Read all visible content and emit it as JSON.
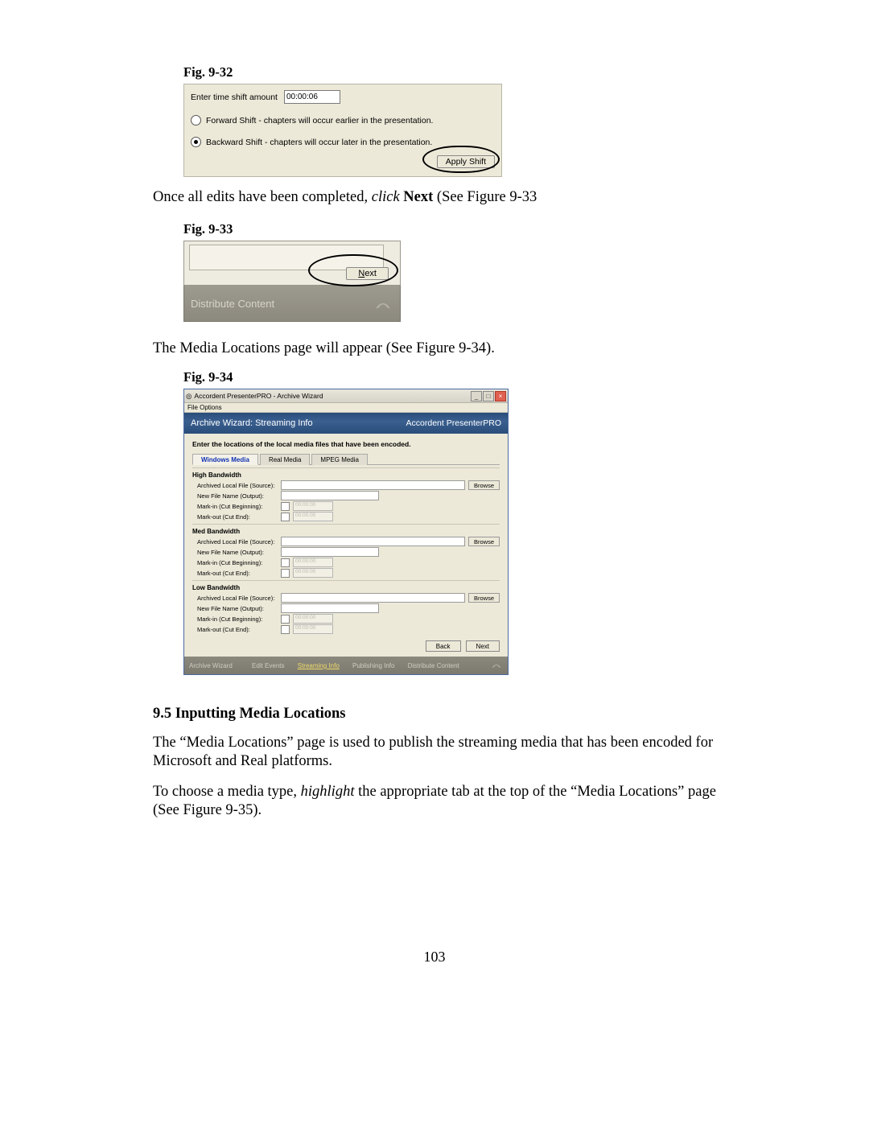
{
  "captions": {
    "fig32": "Fig. 9-32",
    "fig33": "Fig. 9-33",
    "fig34": "Fig.  9-34"
  },
  "paragraphs": {
    "p1_a": "Once all edits have been completed, ",
    "p1_b": "click",
    "p1_c": " Next",
    "p1_d": " (See Figure 9-33",
    "p2": "The Media Locations page will appear (See Figure 9-34).",
    "section": "9.5  Inputting Media Locations",
    "p3": "The “Media Locations” page is used to publish the streaming media that has been encoded for Microsoft and Real platforms.",
    "p4_a": "To choose a media type, ",
    "p4_b": "highlight",
    "p4_c": " the appropriate tab at the top of the “Media Locations” page (See Figure 9-35)."
  },
  "page_number": "103",
  "fig32": {
    "enter_label": "Enter time shift amount",
    "time_value": "00:00:06",
    "opt1": "Forward Shift - chapters will occur earlier in the presentation.",
    "opt2": "Backward Shift - chapters will occur later in the presentation.",
    "apply_btn": "Apply Shift"
  },
  "fig33": {
    "next_u": "N",
    "next_rest": "ext",
    "footer_text": "Distribute Content"
  },
  "fig34": {
    "title": "Accordent PresenterPRO - Archive Wizard",
    "menu": "File   Options",
    "blue_left": "Archive Wizard: Streaming Info",
    "blue_right": "Accordent PresenterPRO",
    "instruction": "Enter the locations of the local media files that have been encoded.",
    "tabs": [
      "Windows Media",
      "Real Media",
      "MPEG Media"
    ],
    "groups": [
      {
        "title": "High Bandwidth"
      },
      {
        "title": "Med Bandwidth"
      },
      {
        "title": "Low Bandwidth"
      }
    ],
    "row_labels": {
      "source": "Archived Local File (Source):",
      "output": "New File Name  (Output):",
      "markin": "Mark-in (Cut Beginning):",
      "markout": "Mark-out (Cut End):"
    },
    "time_placeholder": "00:00:00",
    "browse": "Browse",
    "back": "Back",
    "next": "Next",
    "footer_left": "Archive Wizard",
    "footer_steps": [
      "Edit Events",
      "Streaming Info",
      "Publishing Info",
      "Distribute Content"
    ]
  }
}
